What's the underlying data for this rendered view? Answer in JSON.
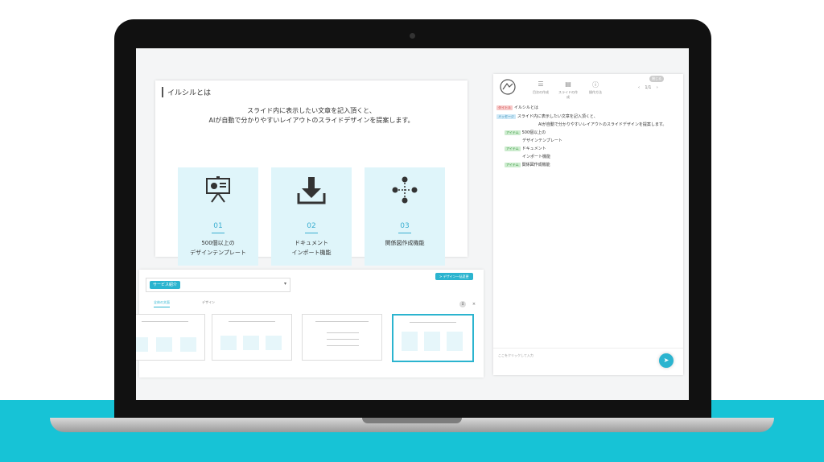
{
  "slide": {
    "heading": "イルシルとは",
    "line1": "スライド内に表示したい文章を記入頂くと、",
    "line2": "AIが自動で分かりやすいレイアウトのスライドデザインを提案します。",
    "cards": [
      {
        "icon": "presentation-board-icon",
        "number": "01",
        "label1": "500個以上の",
        "label2": "デザインテンプレート"
      },
      {
        "icon": "download-icon",
        "number": "02",
        "label1": "ドキュメント",
        "label2": "インポート機能"
      },
      {
        "icon": "relationship-diagram-icon",
        "number": "03",
        "label1": "関係図作成機能",
        "label2": ""
      }
    ]
  },
  "bottom_panel": {
    "select_value": "サービス紹介",
    "change_button": "> デザイン一括変更",
    "tabs": [
      "全体の文面",
      "デザイン"
    ]
  },
  "right_panel": {
    "close_label": "閉じる",
    "tools": [
      {
        "icon": "list-icon",
        "label": "目次の作成"
      },
      {
        "icon": "document-icon",
        "label": "スライドの作成"
      },
      {
        "icon": "help-icon",
        "label": "操作方法"
      }
    ],
    "pager": "1/1",
    "outline": [
      {
        "badge": "タイトル",
        "type": "title",
        "text": "イルシルとは"
      },
      {
        "badge": "メッセージ",
        "type": "msg",
        "text": "スライド内に表示したい文章を記入頂くと、"
      },
      {
        "badge": "",
        "type": "",
        "text": "AIが自動で分かりやすいレイアウトのスライドデザインを提案します。"
      },
      {
        "badge": "アイテム",
        "type": "item",
        "text": "500個以上の"
      },
      {
        "badge": "",
        "type": "",
        "text": "デザインテンプレート"
      },
      {
        "badge": "アイテム",
        "type": "item",
        "text": "ドキュメント"
      },
      {
        "badge": "",
        "type": "",
        "text": "インポート機能"
      },
      {
        "badge": "アイテム",
        "type": "item",
        "text": "関係図作成機能"
      }
    ],
    "input_placeholder": "ここをクリックして入力",
    "send_icon": "send-icon"
  },
  "colors": {
    "accent": "#2bb4cf",
    "card_bg": "#dff5fa",
    "band": "#17c3d6"
  }
}
